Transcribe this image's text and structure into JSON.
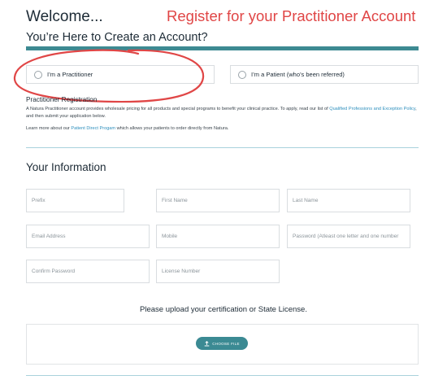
{
  "header": {
    "welcome": "Welcome...",
    "annotation_title": "Register for your Practitioner Account",
    "subtitle": "You’re Here to Create an Account?"
  },
  "account_type": {
    "practitioner_label": "I’m a Practitioner",
    "patient_label": "I’m a Patient (who’s been referred)"
  },
  "registration": {
    "heading": "Practitioner Registration",
    "para1_a": "A Natura Practitioner account provides wholesale pricing for all products and special programs to benefit your clinical practice. To apply, read our list of ",
    "para1_link1": "Qualified Professions and Exception Policy",
    "para1_b": ", and then submit your application below.",
    "para2_a": "Learn more about our ",
    "para2_link": "Patient Direct Progam",
    "para2_b": " which allows your patients to order directly from Natura."
  },
  "your_info": {
    "heading": "Your Information",
    "prefix_placeholder": "Prefix",
    "first_name_placeholder": "First Name",
    "last_name_placeholder": "Last Name",
    "email_placeholder": "Email Address",
    "mobile_placeholder": "Mobile",
    "password_placeholder": "Password (Atleast one letter and one number",
    "confirm_password_placeholder": "Confirm Password",
    "license_placeholder": "License Number"
  },
  "upload": {
    "label": "Please upload your certification or State License.",
    "button_label": "CHOOSE FILE"
  },
  "colors": {
    "accent": "#3d8a92",
    "annotation": "#e04646",
    "link": "#2e8fbd"
  }
}
